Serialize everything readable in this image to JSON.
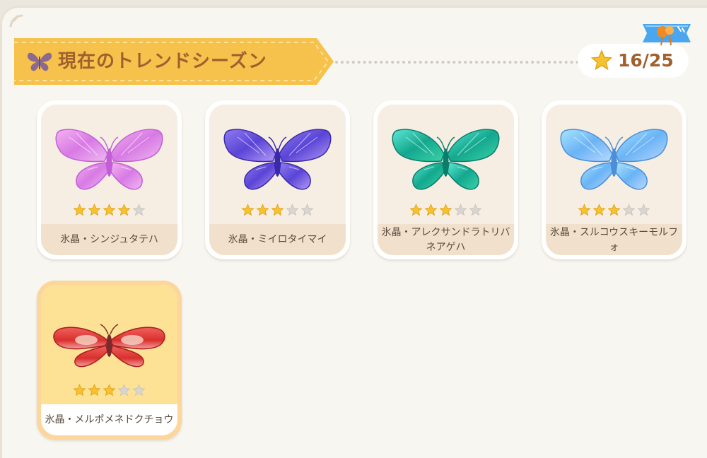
{
  "section": {
    "title": "現在のトレンドシーズン",
    "title_icon": "butterfly-icon",
    "progress_text": "16/25",
    "progress_icon": "star-icon",
    "ribbon_icon": "balloon-badge-icon"
  },
  "colors": {
    "banner": "#f7c24b",
    "title_text": "#a0602f",
    "star_filled": "#f6c22f",
    "star_empty": "#d9d5cf",
    "selected_frame": "#fcd69a"
  },
  "cards": [
    {
      "name": "氷晶・シンジュタテハ",
      "stars": 4,
      "max_stars": 5,
      "icon": "pink-crystal-butterfly",
      "selected": false
    },
    {
      "name": "氷晶・ミイロタイマイ",
      "stars": 3,
      "max_stars": 5,
      "icon": "purple-crystal-butterfly",
      "selected": false
    },
    {
      "name": "氷晶・アレクサンドラトリバネアゲハ",
      "stars": 3,
      "max_stars": 5,
      "icon": "green-crystal-butterfly",
      "selected": false
    },
    {
      "name": "氷晶・スルコウスキーモルフォ",
      "stars": 3,
      "max_stars": 5,
      "icon": "blue-crystal-butterfly",
      "selected": false
    },
    {
      "name": "氷晶・メルポメネドクチョウ",
      "stars": 3,
      "max_stars": 5,
      "icon": "red-crystal-butterfly",
      "selected": true
    }
  ]
}
